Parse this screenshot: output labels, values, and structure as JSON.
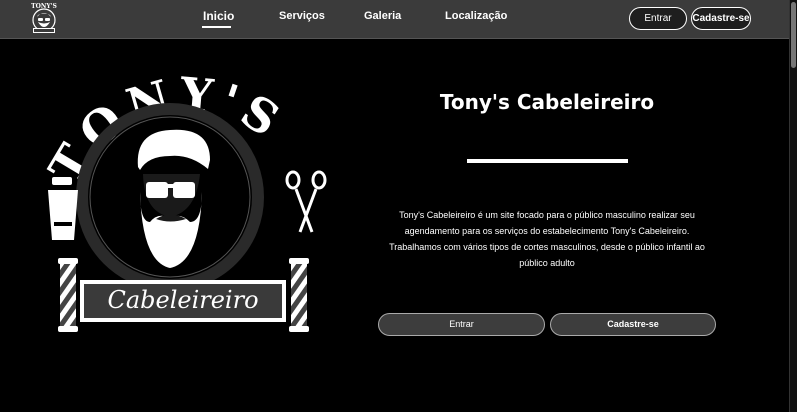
{
  "nav": {
    "links": [
      {
        "label": "Inicio",
        "active": true
      },
      {
        "label": "Serviços",
        "active": false
      },
      {
        "label": "Galeria",
        "active": false
      },
      {
        "label": "Localização",
        "active": false
      }
    ],
    "login_label": "Entrar",
    "signup_label": "Cadastre-se"
  },
  "logo": {
    "arc_text": "TONY'S",
    "banner_text": "Cabeleireiro"
  },
  "hero": {
    "title": "Tony's Cabeleireiro",
    "description": "Tony's Cabeleireiro é um site focado para o público masculino realizar seu agendamento para os serviços do estabelecimento Tony's Cabeleireiro. Trabalhamos com vários tipos de cortes masculinos, desde o público infantil ao público adulto",
    "login_label": "Entrar",
    "signup_label": "Cadastre-se"
  },
  "colors": {
    "background": "#000000",
    "navbar": "#3b3b3b",
    "button": "#3d3d3d"
  }
}
